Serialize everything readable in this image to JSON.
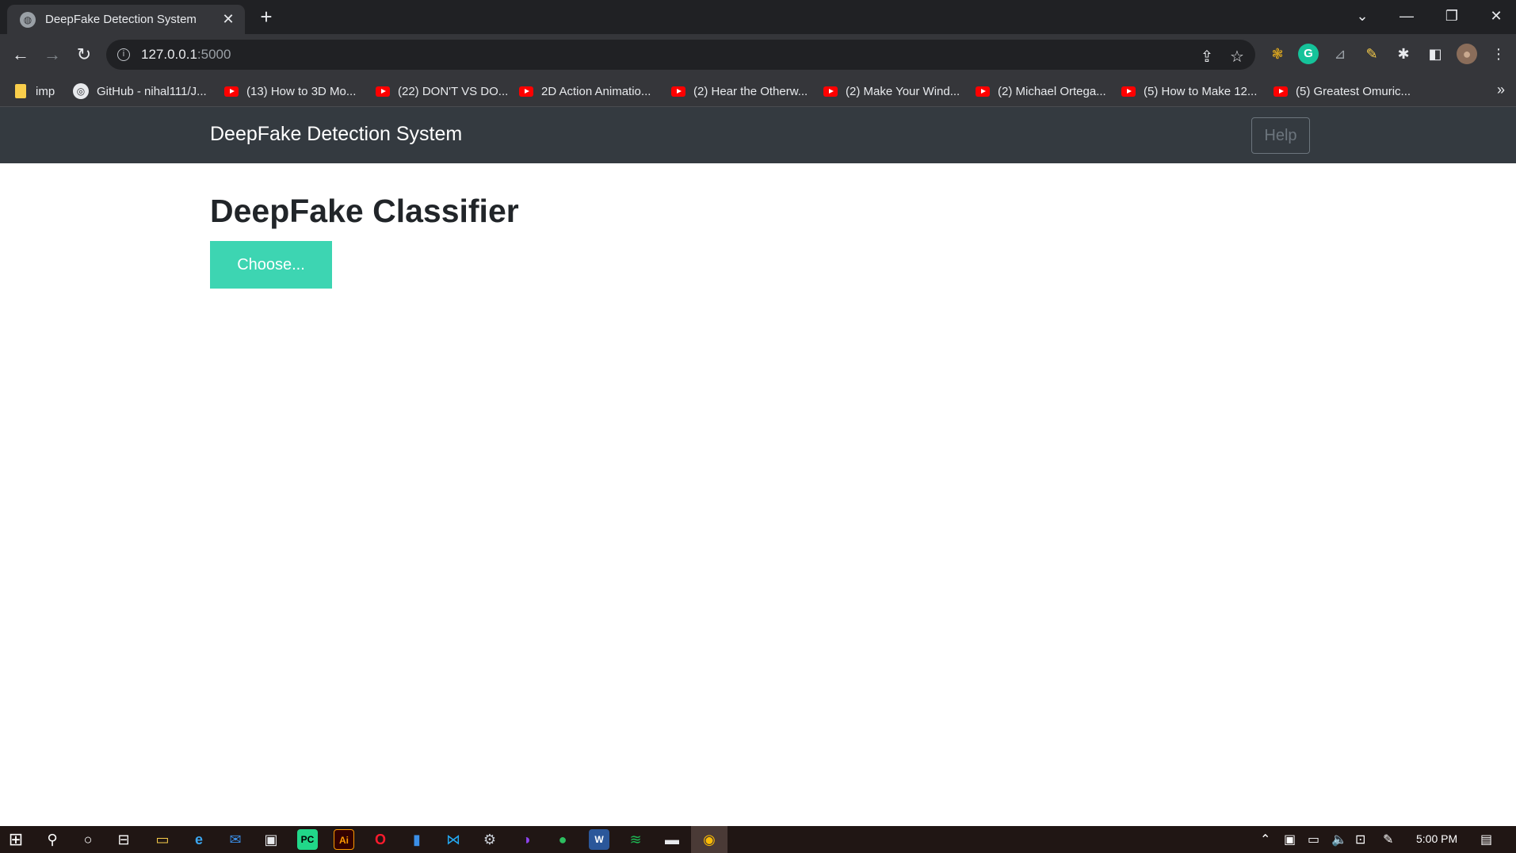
{
  "browser": {
    "tab": {
      "title": "DeepFake Detection System",
      "close_glyph": "✕",
      "favicon": "globe-icon"
    },
    "new_tab_glyph": "+",
    "window_controls": {
      "dropdown": "⌄",
      "minimize": "—",
      "restore": "❐",
      "close": "✕"
    },
    "nav": {
      "back": "←",
      "forward": "→",
      "reload": "↻"
    },
    "url": {
      "host": "127.0.0.1",
      "port": ":5000"
    },
    "omnibox_icons": {
      "share": "⇪",
      "star": "☆"
    },
    "extensions": [
      "❃",
      "G",
      "⊿",
      "✎",
      "✱",
      "◧",
      "●",
      "⋮"
    ],
    "bookmarks": [
      {
        "label": "imp",
        "icon": "folder-icon"
      },
      {
        "label": "GitHub - nihal111/J...",
        "icon": "github-icon"
      },
      {
        "label": "(13) How to 3D Mo...",
        "icon": "youtube-icon"
      },
      {
        "label": "(22) DON'T VS DO...",
        "icon": "youtube-icon"
      },
      {
        "label": "2D Action Animatio...",
        "icon": "youtube-icon"
      },
      {
        "label": "(2) Hear the Otherw...",
        "icon": "youtube-icon"
      },
      {
        "label": "(2) Make Your Wind...",
        "icon": "youtube-icon"
      },
      {
        "label": "(2) Michael Ortega...",
        "icon": "youtube-icon"
      },
      {
        "label": "(5) How to Make 12...",
        "icon": "youtube-icon"
      },
      {
        "label": "(5) Greatest Omuric...",
        "icon": "youtube-icon"
      }
    ],
    "bookmarks_more": "»"
  },
  "page": {
    "brand": "DeepFake Detection System",
    "help_label": "Help",
    "title": "DeepFake Classifier",
    "choose_label": "Choose..."
  },
  "taskbar": {
    "clock": "5:00 PM",
    "apps": [
      "⊞",
      "⚲",
      "○",
      "⊟",
      "▭",
      "e",
      "✉",
      "▣",
      "PC",
      "Ai",
      "O",
      "▮",
      "⋈",
      "⚙",
      "◑",
      "●",
      "W",
      "≋",
      "▬",
      "◉"
    ],
    "tray": [
      "⌃",
      "▣",
      "▭",
      "🔈",
      "⊡",
      "✎",
      "▤"
    ]
  },
  "colors": {
    "accent_button": "#3dd5b2",
    "navbar_bg": "#343a40",
    "taskbar_bg": "#201614"
  }
}
